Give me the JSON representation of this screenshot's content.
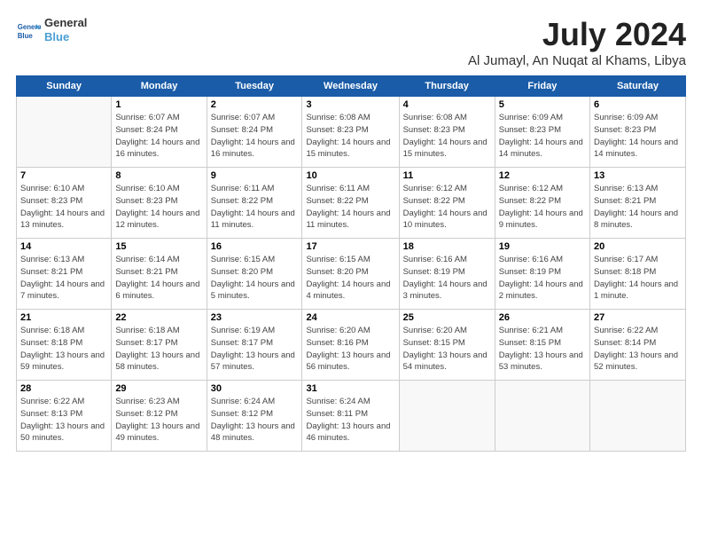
{
  "header": {
    "logo_line1": "General",
    "logo_line2": "Blue",
    "title": "July 2024",
    "subtitle": "Al Jumayl, An Nuqat al Khams, Libya"
  },
  "days_of_week": [
    "Sunday",
    "Monday",
    "Tuesday",
    "Wednesday",
    "Thursday",
    "Friday",
    "Saturday"
  ],
  "weeks": [
    [
      {
        "num": "",
        "sunrise": "",
        "sunset": "",
        "daylight": "",
        "empty": true
      },
      {
        "num": "1",
        "sunrise": "Sunrise: 6:07 AM",
        "sunset": "Sunset: 8:24 PM",
        "daylight": "Daylight: 14 hours and 16 minutes."
      },
      {
        "num": "2",
        "sunrise": "Sunrise: 6:07 AM",
        "sunset": "Sunset: 8:24 PM",
        "daylight": "Daylight: 14 hours and 16 minutes."
      },
      {
        "num": "3",
        "sunrise": "Sunrise: 6:08 AM",
        "sunset": "Sunset: 8:23 PM",
        "daylight": "Daylight: 14 hours and 15 minutes."
      },
      {
        "num": "4",
        "sunrise": "Sunrise: 6:08 AM",
        "sunset": "Sunset: 8:23 PM",
        "daylight": "Daylight: 14 hours and 15 minutes."
      },
      {
        "num": "5",
        "sunrise": "Sunrise: 6:09 AM",
        "sunset": "Sunset: 8:23 PM",
        "daylight": "Daylight: 14 hours and 14 minutes."
      },
      {
        "num": "6",
        "sunrise": "Sunrise: 6:09 AM",
        "sunset": "Sunset: 8:23 PM",
        "daylight": "Daylight: 14 hours and 14 minutes."
      }
    ],
    [
      {
        "num": "7",
        "sunrise": "Sunrise: 6:10 AM",
        "sunset": "Sunset: 8:23 PM",
        "daylight": "Daylight: 14 hours and 13 minutes."
      },
      {
        "num": "8",
        "sunrise": "Sunrise: 6:10 AM",
        "sunset": "Sunset: 8:23 PM",
        "daylight": "Daylight: 14 hours and 12 minutes."
      },
      {
        "num": "9",
        "sunrise": "Sunrise: 6:11 AM",
        "sunset": "Sunset: 8:22 PM",
        "daylight": "Daylight: 14 hours and 11 minutes."
      },
      {
        "num": "10",
        "sunrise": "Sunrise: 6:11 AM",
        "sunset": "Sunset: 8:22 PM",
        "daylight": "Daylight: 14 hours and 11 minutes."
      },
      {
        "num": "11",
        "sunrise": "Sunrise: 6:12 AM",
        "sunset": "Sunset: 8:22 PM",
        "daylight": "Daylight: 14 hours and 10 minutes."
      },
      {
        "num": "12",
        "sunrise": "Sunrise: 6:12 AM",
        "sunset": "Sunset: 8:22 PM",
        "daylight": "Daylight: 14 hours and 9 minutes."
      },
      {
        "num": "13",
        "sunrise": "Sunrise: 6:13 AM",
        "sunset": "Sunset: 8:21 PM",
        "daylight": "Daylight: 14 hours and 8 minutes."
      }
    ],
    [
      {
        "num": "14",
        "sunrise": "Sunrise: 6:13 AM",
        "sunset": "Sunset: 8:21 PM",
        "daylight": "Daylight: 14 hours and 7 minutes."
      },
      {
        "num": "15",
        "sunrise": "Sunrise: 6:14 AM",
        "sunset": "Sunset: 8:21 PM",
        "daylight": "Daylight: 14 hours and 6 minutes."
      },
      {
        "num": "16",
        "sunrise": "Sunrise: 6:15 AM",
        "sunset": "Sunset: 8:20 PM",
        "daylight": "Daylight: 14 hours and 5 minutes."
      },
      {
        "num": "17",
        "sunrise": "Sunrise: 6:15 AM",
        "sunset": "Sunset: 8:20 PM",
        "daylight": "Daylight: 14 hours and 4 minutes."
      },
      {
        "num": "18",
        "sunrise": "Sunrise: 6:16 AM",
        "sunset": "Sunset: 8:19 PM",
        "daylight": "Daylight: 14 hours and 3 minutes."
      },
      {
        "num": "19",
        "sunrise": "Sunrise: 6:16 AM",
        "sunset": "Sunset: 8:19 PM",
        "daylight": "Daylight: 14 hours and 2 minutes."
      },
      {
        "num": "20",
        "sunrise": "Sunrise: 6:17 AM",
        "sunset": "Sunset: 8:18 PM",
        "daylight": "Daylight: 14 hours and 1 minute."
      }
    ],
    [
      {
        "num": "21",
        "sunrise": "Sunrise: 6:18 AM",
        "sunset": "Sunset: 8:18 PM",
        "daylight": "Daylight: 13 hours and 59 minutes."
      },
      {
        "num": "22",
        "sunrise": "Sunrise: 6:18 AM",
        "sunset": "Sunset: 8:17 PM",
        "daylight": "Daylight: 13 hours and 58 minutes."
      },
      {
        "num": "23",
        "sunrise": "Sunrise: 6:19 AM",
        "sunset": "Sunset: 8:17 PM",
        "daylight": "Daylight: 13 hours and 57 minutes."
      },
      {
        "num": "24",
        "sunrise": "Sunrise: 6:20 AM",
        "sunset": "Sunset: 8:16 PM",
        "daylight": "Daylight: 13 hours and 56 minutes."
      },
      {
        "num": "25",
        "sunrise": "Sunrise: 6:20 AM",
        "sunset": "Sunset: 8:15 PM",
        "daylight": "Daylight: 13 hours and 54 minutes."
      },
      {
        "num": "26",
        "sunrise": "Sunrise: 6:21 AM",
        "sunset": "Sunset: 8:15 PM",
        "daylight": "Daylight: 13 hours and 53 minutes."
      },
      {
        "num": "27",
        "sunrise": "Sunrise: 6:22 AM",
        "sunset": "Sunset: 8:14 PM",
        "daylight": "Daylight: 13 hours and 52 minutes."
      }
    ],
    [
      {
        "num": "28",
        "sunrise": "Sunrise: 6:22 AM",
        "sunset": "Sunset: 8:13 PM",
        "daylight": "Daylight: 13 hours and 50 minutes."
      },
      {
        "num": "29",
        "sunrise": "Sunrise: 6:23 AM",
        "sunset": "Sunset: 8:12 PM",
        "daylight": "Daylight: 13 hours and 49 minutes."
      },
      {
        "num": "30",
        "sunrise": "Sunrise: 6:24 AM",
        "sunset": "Sunset: 8:12 PM",
        "daylight": "Daylight: 13 hours and 48 minutes."
      },
      {
        "num": "31",
        "sunrise": "Sunrise: 6:24 AM",
        "sunset": "Sunset: 8:11 PM",
        "daylight": "Daylight: 13 hours and 46 minutes."
      },
      {
        "num": "",
        "sunrise": "",
        "sunset": "",
        "daylight": "",
        "empty": true
      },
      {
        "num": "",
        "sunrise": "",
        "sunset": "",
        "daylight": "",
        "empty": true
      },
      {
        "num": "",
        "sunrise": "",
        "sunset": "",
        "daylight": "",
        "empty": true
      }
    ]
  ]
}
